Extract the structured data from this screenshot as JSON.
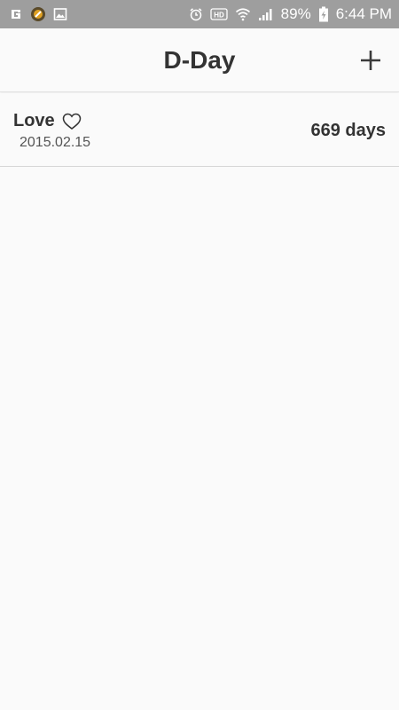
{
  "status_bar": {
    "battery_percent": "89%",
    "time": "6:44 PM",
    "left_icons": [
      "app-g-icon",
      "app-badge-icon",
      "image-icon"
    ],
    "right_icons": [
      "alarm-icon",
      "hd-icon",
      "wifi-icon",
      "signal-icon",
      "battery-charging-icon"
    ],
    "hd_label": "HD"
  },
  "app_bar": {
    "title": "D-Day",
    "add_icon": "plus-icon"
  },
  "list": {
    "items": [
      {
        "title": "Love",
        "title_icon": "heart-outline-icon",
        "date": "2015.02.15",
        "count": "669 days"
      }
    ]
  },
  "colors": {
    "status_bar_bg": "#9e9e9e",
    "app_bg": "#fafafa",
    "text_primary": "#333333",
    "text_secondary": "#555555",
    "divider": "#d6d6d6"
  }
}
